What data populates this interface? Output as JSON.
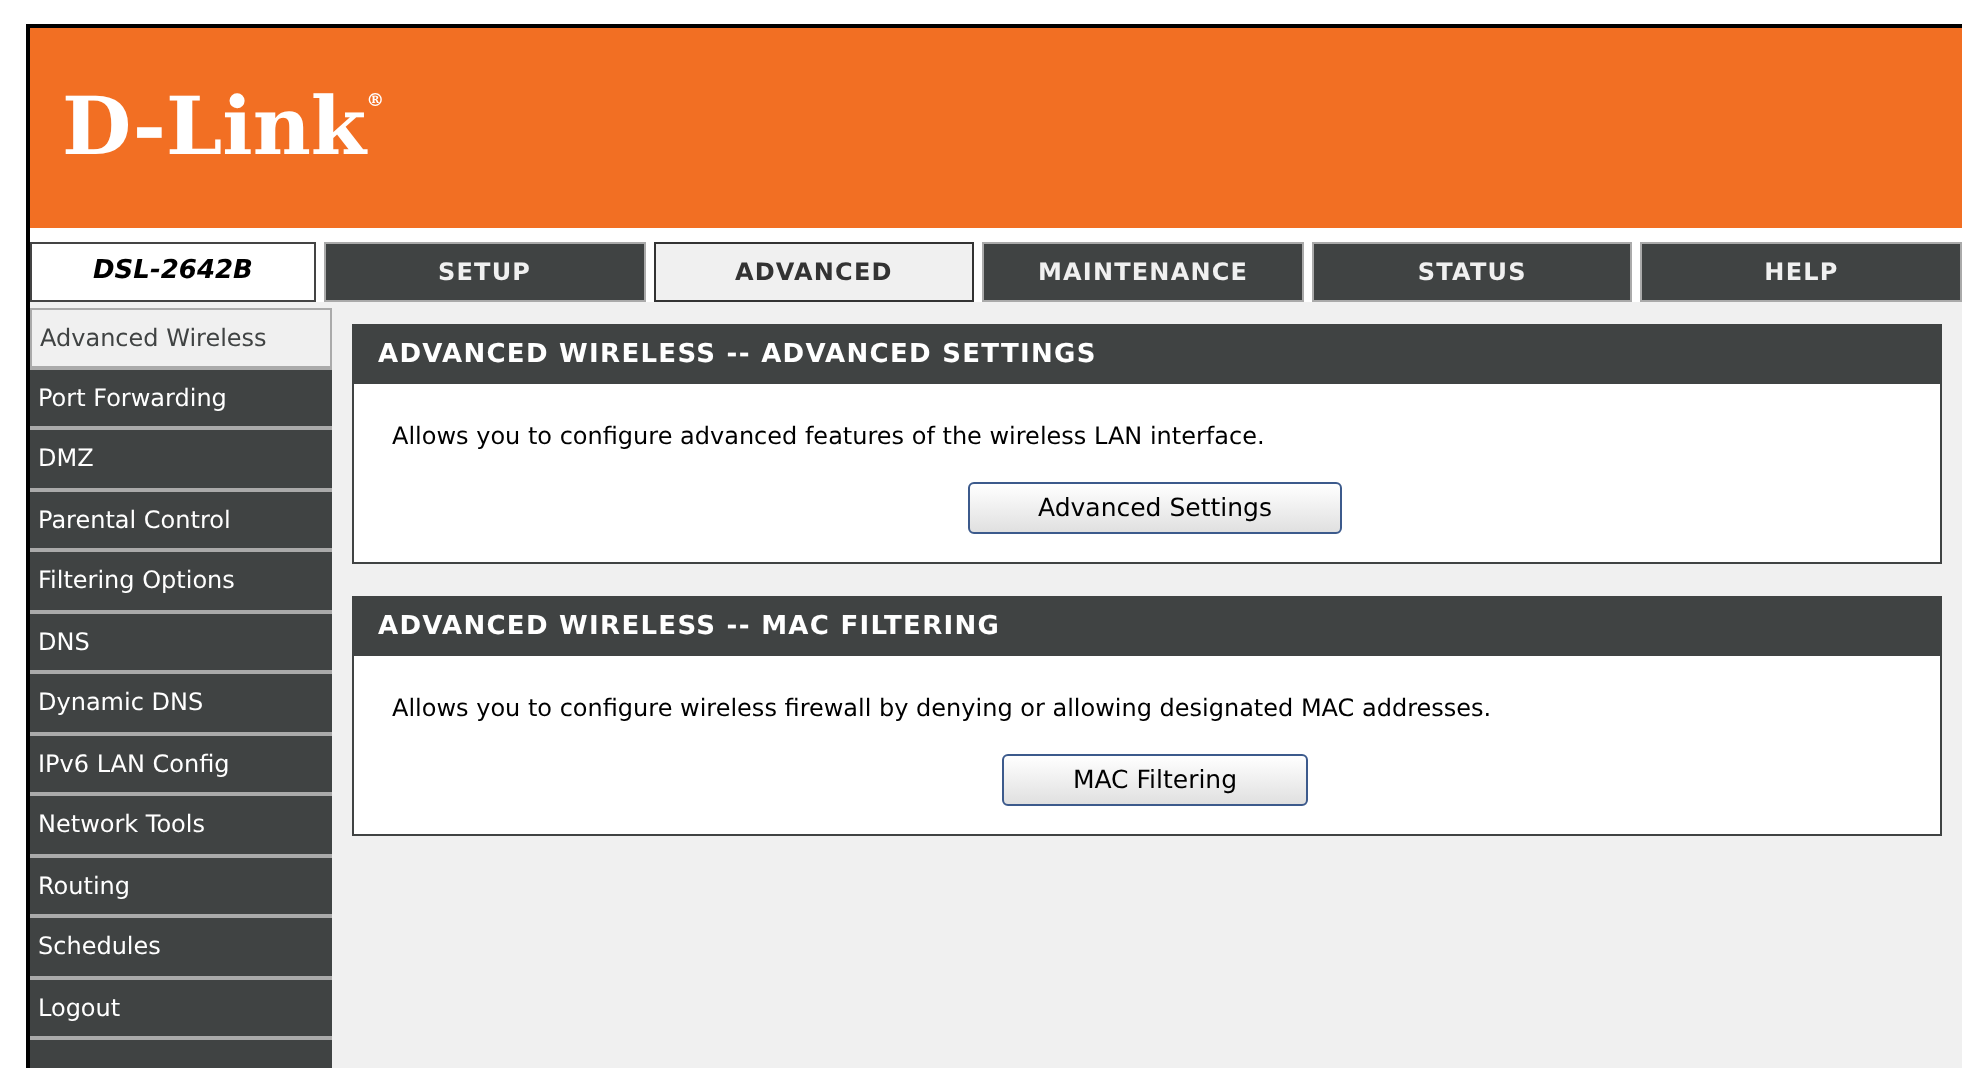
{
  "logo": {
    "text": "D-Link",
    "mark": "®"
  },
  "model": "DSL-2642B",
  "tabs": [
    {
      "label": "SETUP",
      "selected": false
    },
    {
      "label": "ADVANCED",
      "selected": true
    },
    {
      "label": "MAINTENANCE",
      "selected": false
    },
    {
      "label": "STATUS",
      "selected": false
    },
    {
      "label": "HELP",
      "selected": false
    }
  ],
  "sidebar": {
    "items": [
      {
        "label": "Advanced Wireless",
        "selected": true
      },
      {
        "label": "Port Forwarding",
        "selected": false
      },
      {
        "label": "DMZ",
        "selected": false
      },
      {
        "label": "Parental Control",
        "selected": false
      },
      {
        "label": "Filtering Options",
        "selected": false
      },
      {
        "label": "DNS",
        "selected": false
      },
      {
        "label": "Dynamic DNS",
        "selected": false
      },
      {
        "label": "IPv6 LAN Config",
        "selected": false
      },
      {
        "label": "Network Tools",
        "selected": false
      },
      {
        "label": "Routing",
        "selected": false
      },
      {
        "label": "Schedules",
        "selected": false
      },
      {
        "label": "Logout",
        "selected": false
      }
    ]
  },
  "sections": [
    {
      "title": "ADVANCED WIRELESS -- ADVANCED SETTINGS",
      "description": "Allows you to configure advanced features of the wireless LAN interface.",
      "button": "Advanced Settings"
    },
    {
      "title": "ADVANCED WIRELESS -- MAC FILTERING",
      "description": "Allows you to configure wireless firewall by denying or allowing designated MAC addresses.",
      "button": "MAC Filtering"
    }
  ]
}
